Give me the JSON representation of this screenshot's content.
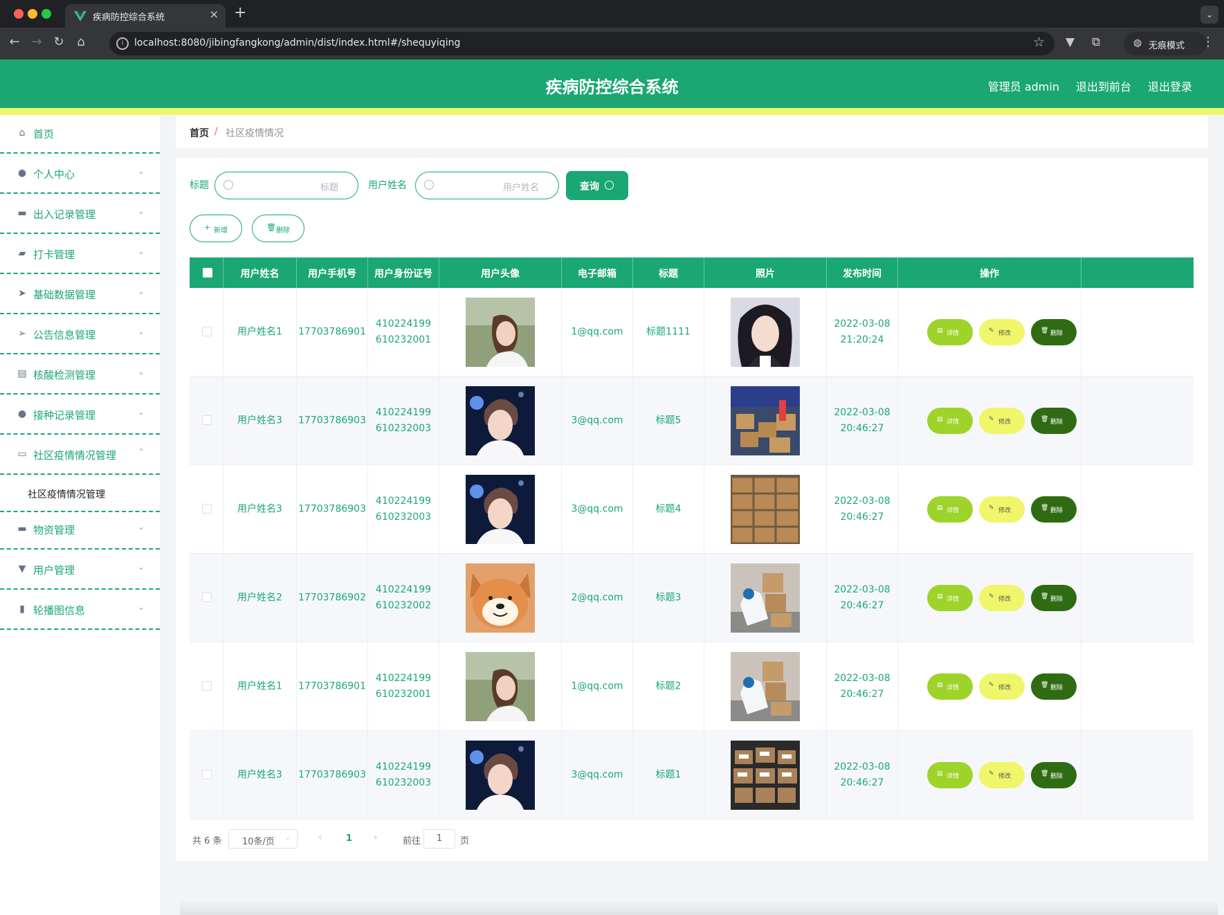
{
  "browser": {
    "tab_title": "疾病防控综合系统",
    "url": "localhost:8080/jibingfangkong/admin/dist/index.html#/shequyiqing",
    "incognito_label": "无痕模式",
    "colors": {
      "close": "#ff5f57",
      "minimize": "#febc2e",
      "maximize": "#28c840"
    }
  },
  "header": {
    "title": "疾病防控综合系统",
    "links": [
      "管理员 admin",
      "退出到前台",
      "退出登录"
    ]
  },
  "sidebar": {
    "items": [
      {
        "label": "首页",
        "icon": "home-icon",
        "glyph": "⌂",
        "arrow": ""
      },
      {
        "label": "个人中心",
        "icon": "user-icon",
        "glyph": "●",
        "arrow": "⌄"
      },
      {
        "label": "出入记录管理",
        "icon": "box-icon",
        "glyph": "▬",
        "arrow": "⌄"
      },
      {
        "label": "打卡管理",
        "icon": "wallet-icon",
        "glyph": "▰",
        "arrow": "⌄"
      },
      {
        "label": "基础数据管理",
        "icon": "send-icon",
        "glyph": "➤",
        "arrow": "⌄"
      },
      {
        "label": "公告信息管理",
        "icon": "position-icon",
        "glyph": "➢",
        "arrow": "⌄"
      },
      {
        "label": "核酸检测管理",
        "icon": "suitcase-icon",
        "glyph": "▤",
        "arrow": "⌄"
      },
      {
        "label": "接种记录管理",
        "icon": "user-icon",
        "glyph": "●",
        "arrow": "⌄"
      },
      {
        "label": "社区疫情情况管理",
        "icon": "chat-icon",
        "glyph": "▭",
        "arrow": "⌃"
      },
      {
        "label": "物资管理",
        "icon": "chat-icon",
        "glyph": "▬",
        "arrow": "⌄"
      },
      {
        "label": "用户管理",
        "icon": "flag-icon",
        "glyph": "▼",
        "arrow": "⌄"
      },
      {
        "label": "轮播图信息",
        "icon": "chart-icon",
        "glyph": "▮",
        "arrow": "⌄"
      }
    ],
    "submenu": "社区疫情情况管理"
  },
  "breadcrumb": {
    "home": "首页",
    "separator": "/",
    "current": "社区疫情情况"
  },
  "search": {
    "title_label": "标题",
    "title_placeholder": "标题",
    "name_label": "用户姓名",
    "name_placeholder": "用户姓名",
    "query_label": "查询"
  },
  "actions": {
    "add_label": "新增",
    "delete_label": "删除"
  },
  "table": {
    "headers": [
      "用户姓名",
      "用户手机号",
      "用户身份证号",
      "用户头像",
      "电子邮箱",
      "标题",
      "照片",
      "发布时间",
      "操作"
    ],
    "rows": [
      {
        "name": "用户姓名1",
        "phone": "17703786901",
        "id_card": "410224199610232001",
        "avatar": "avatar-girl",
        "email": "1@qq.com",
        "title": "标题1111",
        "photo": "photo-portrait",
        "time": "2022-03-08 21:20:24"
      },
      {
        "name": "用户姓名3",
        "phone": "17703786903",
        "id_card": "410224199610232003",
        "avatar": "avatar-boy",
        "email": "3@qq.com",
        "title": "标题5",
        "photo": "photo-boxes-tent",
        "time": "2022-03-08 20:46:27"
      },
      {
        "name": "用户姓名3",
        "phone": "17703786903",
        "id_card": "410224199610232003",
        "avatar": "avatar-boy",
        "email": "3@qq.com",
        "title": "标题4",
        "photo": "photo-boxes-stack",
        "time": "2022-03-08 20:46:27"
      },
      {
        "name": "用户姓名2",
        "phone": "17703786902",
        "id_card": "410224199610232002",
        "avatar": "avatar-dog",
        "email": "2@qq.com",
        "title": "标题3",
        "photo": "photo-worker",
        "time": "2022-03-08 20:46:27"
      },
      {
        "name": "用户姓名1",
        "phone": "17703786901",
        "id_card": "410224199610232001",
        "avatar": "avatar-girl",
        "email": "1@qq.com",
        "title": "标题2",
        "photo": "photo-worker",
        "time": "2022-03-08 20:46:27"
      },
      {
        "name": "用户姓名3",
        "phone": "17703786903",
        "id_card": "410224199610232003",
        "avatar": "avatar-boy",
        "email": "3@qq.com",
        "title": "标题1",
        "photo": "photo-boxes-dark",
        "time": "2022-03-08 20:46:27"
      }
    ],
    "row_buttons": {
      "detail": "详情",
      "edit": "修改",
      "delete": "删除"
    }
  },
  "pagination": {
    "total": "共 6 条",
    "page_size": "10条/页",
    "current_page": "1",
    "goto_prefix": "前往",
    "goto_value": "1",
    "goto_suffix": "页"
  },
  "colors": {
    "primary": "#1aa774",
    "header_bar": "#eef76a",
    "detail_button": "#9ed32a",
    "edit_button": "#f0f66a",
    "delete_button": "#2f6b12"
  }
}
